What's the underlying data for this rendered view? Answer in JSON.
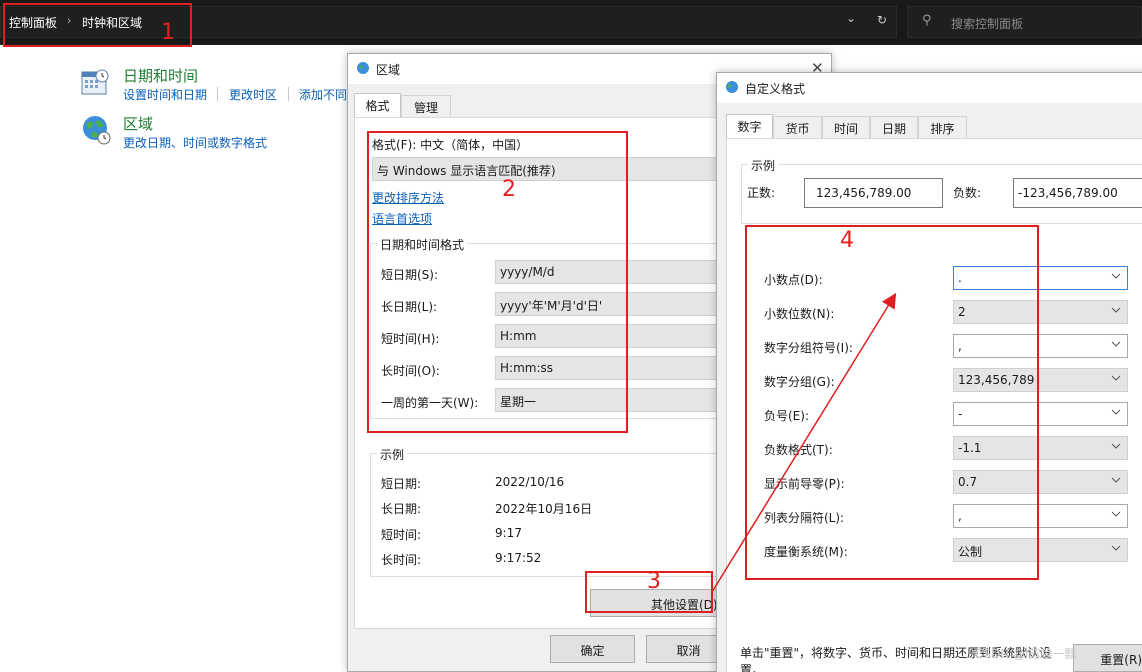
{
  "topbar": {
    "breadcrumb_root": "控制面板",
    "breadcrumb_sep": "›",
    "breadcrumb_current": "时钟和区域",
    "dropdown_glyph": "⌄",
    "refresh_glyph": "↻",
    "search_placeholder": "搜索控制面板"
  },
  "control_panel": {
    "datetime_title": "日期和时间",
    "datetime_links": [
      "设置时间和日期",
      "更改时区",
      "添加不同"
    ],
    "region_title": "区域",
    "region_link": "更改日期、时间或数字格式"
  },
  "region_window": {
    "title": "区域",
    "tabs": [
      "格式",
      "管理"
    ],
    "format_label": "格式(F): 中文（简体，中国）",
    "format_value": "与 Windows 显示语言匹配(推荐)",
    "link_sort": "更改排序方法",
    "link_lang": "语言首选项",
    "datetime_group": "日期和时间格式",
    "formats": [
      {
        "label": "短日期(S):",
        "value": "yyyy/M/d"
      },
      {
        "label": "长日期(L):",
        "value": "yyyy'年'M'月'd'日'"
      },
      {
        "label": "短时间(H):",
        "value": "H:mm"
      },
      {
        "label": "长时间(O):",
        "value": "H:mm:ss"
      },
      {
        "label": "一周的第一天(W):",
        "value": "星期一"
      }
    ],
    "example_group": "示例",
    "examples": [
      {
        "label": "短日期:",
        "value": "2022/10/16"
      },
      {
        "label": "长日期:",
        "value": "2022年10月16日"
      },
      {
        "label": "短时间:",
        "value": "9:17"
      },
      {
        "label": "长时间:",
        "value": "9:17:52"
      }
    ],
    "other_settings": "其他设置(D)",
    "ok": "确定",
    "cancel": "取消"
  },
  "custom_window": {
    "title": "自定义格式",
    "tabs": [
      "数字",
      "货币",
      "时间",
      "日期",
      "排序"
    ],
    "example_group": "示例",
    "positive_label": "正数:",
    "positive_value": "123,456,789.00",
    "negative_label": "负数:",
    "negative_value": "-123,456,789.00",
    "settings": [
      {
        "label": "小数点(D):",
        "value": "."
      },
      {
        "label": "小数位数(N):",
        "value": "2"
      },
      {
        "label": "数字分组符号(I):",
        "value": ","
      },
      {
        "label": "数字分组(G):",
        "value": "123,456,789"
      },
      {
        "label": "负号(E):",
        "value": "-"
      },
      {
        "label": "负数格式(T):",
        "value": "-1.1"
      },
      {
        "label": "显示前导零(P):",
        "value": "0.7"
      },
      {
        "label": "列表分隔符(L):",
        "value": ","
      },
      {
        "label": "度量衡系统(M):",
        "value": "公制"
      }
    ],
    "footer_line1": "单击\"重置\"，将数字、货币、时间和日期还原到系统默认设",
    "footer_line2": "置。",
    "reset": "重置(R)"
  },
  "annotations": [
    "1",
    "2",
    "3",
    "4"
  ],
  "watermark": "CSDN @l苏嗑一瓢",
  "colors": {
    "accent_red": "#e02020",
    "link_blue": "#0b5fb6",
    "title_green": "#1e7d32"
  }
}
